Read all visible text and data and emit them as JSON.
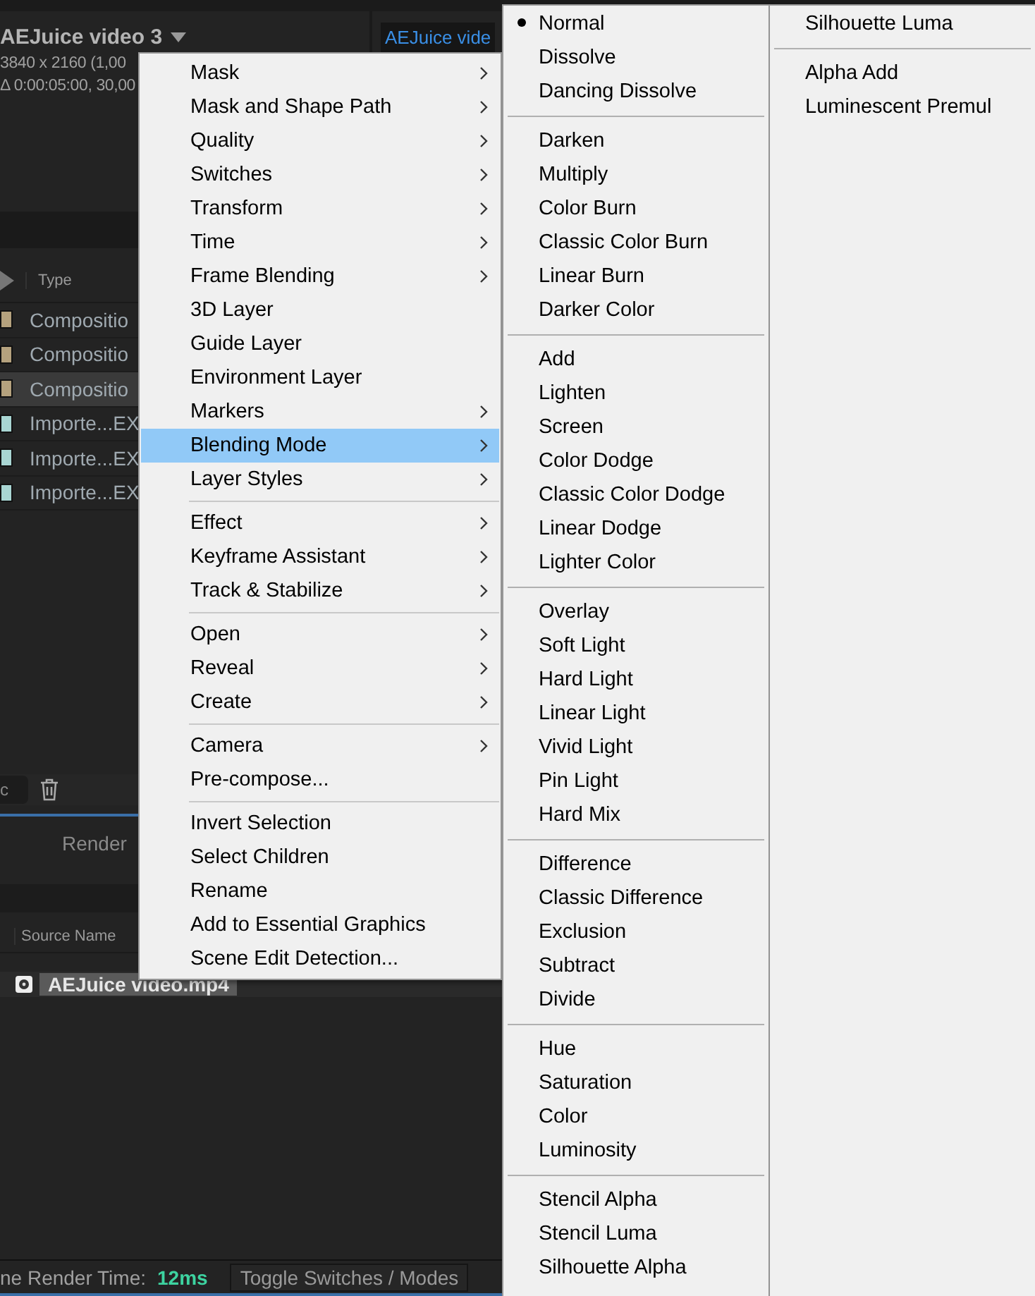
{
  "project_panel": {
    "title": "AEJuice video 3",
    "info": [
      "3840 x 2160 (1,00",
      "Δ 0:00:05:00, 30,00"
    ],
    "type_header": "Type",
    "rows": [
      {
        "label": "Compositio",
        "selected": false,
        "color": "#b5a27e"
      },
      {
        "label": "Compositio",
        "selected": false,
        "color": "#b5a27e"
      },
      {
        "label": "Compositio",
        "selected": true,
        "color": "#b5a27e"
      },
      {
        "label": "Importe...EX",
        "selected": false,
        "color": "#a9d6d3"
      },
      {
        "label": "Importe...EX",
        "selected": false,
        "color": "#a9d6d3"
      },
      {
        "label": "Importe...EX",
        "selected": false,
        "color": "#a9d6d3"
      }
    ],
    "search_value": "c"
  },
  "viewer_tab": "AEJuice vide",
  "render_queue": "Render",
  "timeline": {
    "column": "Source Name",
    "layer": "AEJuice video.mp4"
  },
  "status_bar": {
    "label": "ne Render Time:",
    "value": "12ms",
    "toggle": "Toggle Switches / Modes"
  },
  "context_menu": {
    "groups": [
      [
        {
          "label": "Mask",
          "submenu": true,
          "selected": false
        },
        {
          "label": "Mask and Shape Path",
          "submenu": true,
          "selected": false
        },
        {
          "label": "Quality",
          "submenu": true,
          "selected": false
        },
        {
          "label": "Switches",
          "submenu": true,
          "selected": false
        },
        {
          "label": "Transform",
          "submenu": true,
          "selected": false
        },
        {
          "label": "Time",
          "submenu": true,
          "selected": false
        },
        {
          "label": "Frame Blending",
          "submenu": true,
          "selected": false
        },
        {
          "label": "3D Layer",
          "submenu": false,
          "selected": false
        },
        {
          "label": "Guide Layer",
          "submenu": false,
          "selected": false
        },
        {
          "label": "Environment Layer",
          "submenu": false,
          "selected": false
        },
        {
          "label": "Markers",
          "submenu": true,
          "selected": false
        },
        {
          "label": "Blending Mode",
          "submenu": true,
          "selected": true
        },
        {
          "label": "Layer Styles",
          "submenu": true,
          "selected": false
        }
      ],
      [
        {
          "label": "Effect",
          "submenu": true,
          "selected": false
        },
        {
          "label": "Keyframe Assistant",
          "submenu": true,
          "selected": false
        },
        {
          "label": "Track & Stabilize",
          "submenu": true,
          "selected": false
        }
      ],
      [
        {
          "label": "Open",
          "submenu": true,
          "selected": false
        },
        {
          "label": "Reveal",
          "submenu": true,
          "selected": false
        },
        {
          "label": "Create",
          "submenu": true,
          "selected": false
        }
      ],
      [
        {
          "label": "Camera",
          "submenu": true,
          "selected": false
        },
        {
          "label": "Pre-compose...",
          "submenu": false,
          "selected": false
        }
      ],
      [
        {
          "label": "Invert Selection",
          "submenu": false,
          "selected": false
        },
        {
          "label": "Select Children",
          "submenu": false,
          "selected": false
        },
        {
          "label": "Rename",
          "submenu": false,
          "selected": false
        },
        {
          "label": "Add to Essential Graphics",
          "submenu": false,
          "selected": false
        },
        {
          "label": "Scene Edit Detection...",
          "submenu": false,
          "selected": false
        }
      ]
    ]
  },
  "blending_menu": {
    "columns": [
      [
        [
          {
            "label": "Normal",
            "selected": true
          },
          {
            "label": "Dissolve",
            "selected": false
          },
          {
            "label": "Dancing Dissolve",
            "selected": false
          }
        ],
        [
          {
            "label": "Darken",
            "selected": false
          },
          {
            "label": "Multiply",
            "selected": false
          },
          {
            "label": "Color Burn",
            "selected": false
          },
          {
            "label": "Classic Color Burn",
            "selected": false
          },
          {
            "label": "Linear Burn",
            "selected": false
          },
          {
            "label": "Darker Color",
            "selected": false
          }
        ],
        [
          {
            "label": "Add",
            "selected": false
          },
          {
            "label": "Lighten",
            "selected": false
          },
          {
            "label": "Screen",
            "selected": false
          },
          {
            "label": "Color Dodge",
            "selected": false
          },
          {
            "label": "Classic Color Dodge",
            "selected": false
          },
          {
            "label": "Linear Dodge",
            "selected": false
          },
          {
            "label": "Lighter Color",
            "selected": false
          }
        ],
        [
          {
            "label": "Overlay",
            "selected": false
          },
          {
            "label": "Soft Light",
            "selected": false
          },
          {
            "label": "Hard Light",
            "selected": false
          },
          {
            "label": "Linear Light",
            "selected": false
          },
          {
            "label": "Vivid Light",
            "selected": false
          },
          {
            "label": "Pin Light",
            "selected": false
          },
          {
            "label": "Hard Mix",
            "selected": false
          }
        ],
        [
          {
            "label": "Difference",
            "selected": false
          },
          {
            "label": "Classic Difference",
            "selected": false
          },
          {
            "label": "Exclusion",
            "selected": false
          },
          {
            "label": "Subtract",
            "selected": false
          },
          {
            "label": "Divide",
            "selected": false
          }
        ],
        [
          {
            "label": "Hue",
            "selected": false
          },
          {
            "label": "Saturation",
            "selected": false
          },
          {
            "label": "Color",
            "selected": false
          },
          {
            "label": "Luminosity",
            "selected": false
          }
        ],
        [
          {
            "label": "Stencil Alpha",
            "selected": false
          },
          {
            "label": "Stencil Luma",
            "selected": false
          },
          {
            "label": "Silhouette Alpha",
            "selected": false
          }
        ]
      ],
      [
        [
          {
            "label": "Silhouette Luma",
            "selected": false
          }
        ],
        [
          {
            "label": "Alpha Add",
            "selected": false
          },
          {
            "label": "Luminescent Premul",
            "selected": false
          }
        ]
      ]
    ]
  }
}
